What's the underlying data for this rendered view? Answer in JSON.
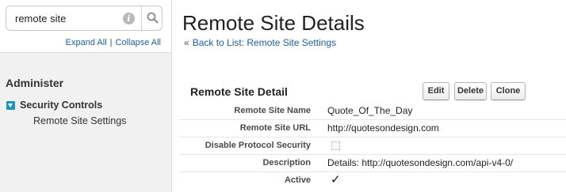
{
  "sidebar": {
    "search": {
      "value": "remote site",
      "placeholder": ""
    },
    "expand_all": "Expand All",
    "separator": "|",
    "collapse_all": "Collapse All",
    "section_heading": "Administer",
    "tree": {
      "node_label": "Security Controls",
      "leaf_label": "Remote Site Settings"
    }
  },
  "main": {
    "page_title": "Remote Site Details",
    "breadcrumb_arrow": "«",
    "breadcrumb_link": "Back to List: Remote Site Settings",
    "section_title": "Remote Site Detail",
    "buttons": {
      "edit": "Edit",
      "delete": "Delete",
      "clone": "Clone"
    },
    "fields": {
      "name": {
        "label": "Remote Site Name",
        "value": "Quote_Of_The_Day"
      },
      "url": {
        "label": "Remote Site URL",
        "value": "http://quotesondesign.com"
      },
      "disable_protocol": {
        "label": "Disable Protocol Security",
        "checked": false
      },
      "description": {
        "label": "Description",
        "value": "Details: http://quotesondesign.com/api-v4-0/"
      },
      "active": {
        "label": "Active",
        "checked": true,
        "mark": "✓"
      }
    }
  },
  "icons": {
    "info": "i",
    "search": "search-icon",
    "toggle": "chevron-down-icon"
  },
  "colors": {
    "link": "#1b5fa8",
    "toggle": "#1797c0",
    "sidebar_bg": "#f1f1f1"
  }
}
